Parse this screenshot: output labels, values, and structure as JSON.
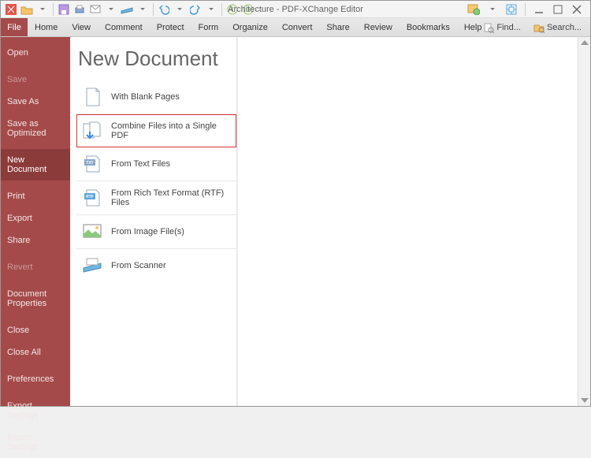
{
  "title": "Architecture - PDF-XChange Editor",
  "menubar": {
    "file": "File",
    "items": [
      "Home",
      "View",
      "Comment",
      "Protect",
      "Form",
      "Organize",
      "Convert",
      "Share",
      "Review",
      "Bookmarks",
      "Help"
    ],
    "find": "Find...",
    "search": "Search..."
  },
  "sidebar": {
    "open": "Open",
    "save": "Save",
    "save_as": "Save As",
    "save_optimized": "Save as Optimized",
    "new_document": "New Document",
    "print": "Print",
    "export": "Export",
    "share": "Share",
    "revert": "Revert",
    "doc_props": "Document Properties",
    "close": "Close",
    "close_all": "Close All",
    "preferences": "Preferences",
    "export_settings": "Export Settings",
    "import_settings": "Import Settings"
  },
  "panel": {
    "title": "New Document",
    "blank": "With Blank Pages",
    "combine": "Combine Files into a Single PDF",
    "text": "From Text Files",
    "rtf": "From Rich Text Format (RTF) Files",
    "image": "From Image File(s)",
    "scanner": "From Scanner"
  }
}
